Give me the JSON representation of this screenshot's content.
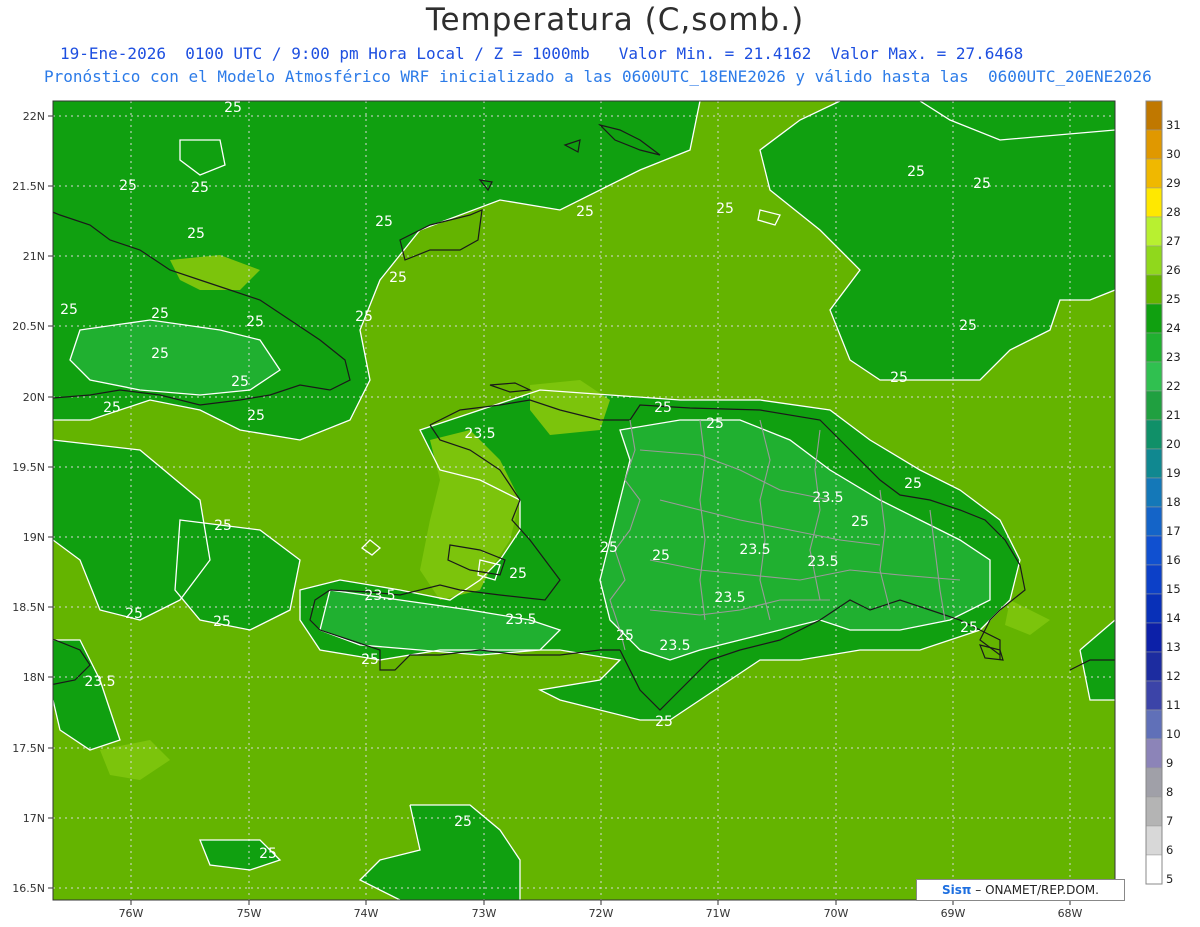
{
  "header": {
    "title": "Temperatura (C,somb.)",
    "line1": "19-Ene-2026  0100 UTC / 9:00 pm Hora Local / Z = 1000mb   Valor Min. = 21.4162  Valor Max. = 27.6468",
    "line2": "Pronóstico con el Modelo Atmosférico WRF inicializado a las 0600UTC_18ENE2026 y válido hasta las  0600UTC_20ENE2026"
  },
  "axes": {
    "lat_labels": [
      "22N",
      "21.5N",
      "21N",
      "20.5N",
      "20N",
      "19.5N",
      "19N",
      "18.5N",
      "18N",
      "17.5N",
      "17N",
      "16.5N"
    ],
    "lon_labels": [
      "76W",
      "75W",
      "74W",
      "73W",
      "72W",
      "71W",
      "70W",
      "69W",
      "68W"
    ]
  },
  "colorbar": {
    "levels": [
      "31",
      "30",
      "29",
      "28",
      "27",
      "26",
      "25",
      "24",
      "23",
      "22",
      "21",
      "20",
      "19",
      "18",
      "17",
      "16",
      "15",
      "14",
      "13",
      "12",
      "11",
      "10",
      "9",
      "8",
      "7",
      "6",
      "5"
    ],
    "colors": [
      "#c07800",
      "#e09800",
      "#f0b800",
      "#ffe800",
      "#b8f030",
      "#90d81c",
      "#64b400",
      "#10a010",
      "#20b030",
      "#30c050",
      "#20a040",
      "#109068",
      "#108890",
      "#1478b8",
      "#1464c8",
      "#1050d0",
      "#0c40c8",
      "#0830b8",
      "#0c20a8",
      "#1c2ca0",
      "#3c44a8",
      "#6070b8",
      "#8c84b8",
      "#a0a0a8",
      "#b4b4b4",
      "#d8d8d8",
      "#ffffff"
    ]
  },
  "contour_labels": [
    "25",
    "25",
    "25",
    "25",
    "25",
    "25",
    "25",
    "25",
    "25",
    "25",
    "25",
    "25",
    "25",
    "25",
    "23.5",
    "25",
    "25",
    "25",
    "25",
    "25",
    "23.5",
    "25",
    "25",
    "23.5",
    "23.5",
    "23.5",
    "23.5",
    "23.5",
    "25",
    "23.5",
    "25",
    "25",
    "25",
    "25",
    "23.5",
    "25",
    "25",
    "25",
    "25",
    "25",
    "25",
    "25",
    "25",
    "25",
    "25"
  ],
  "credit": {
    "logo": "Sisπ",
    "text": "– ONAMET/REP.DOM."
  }
}
